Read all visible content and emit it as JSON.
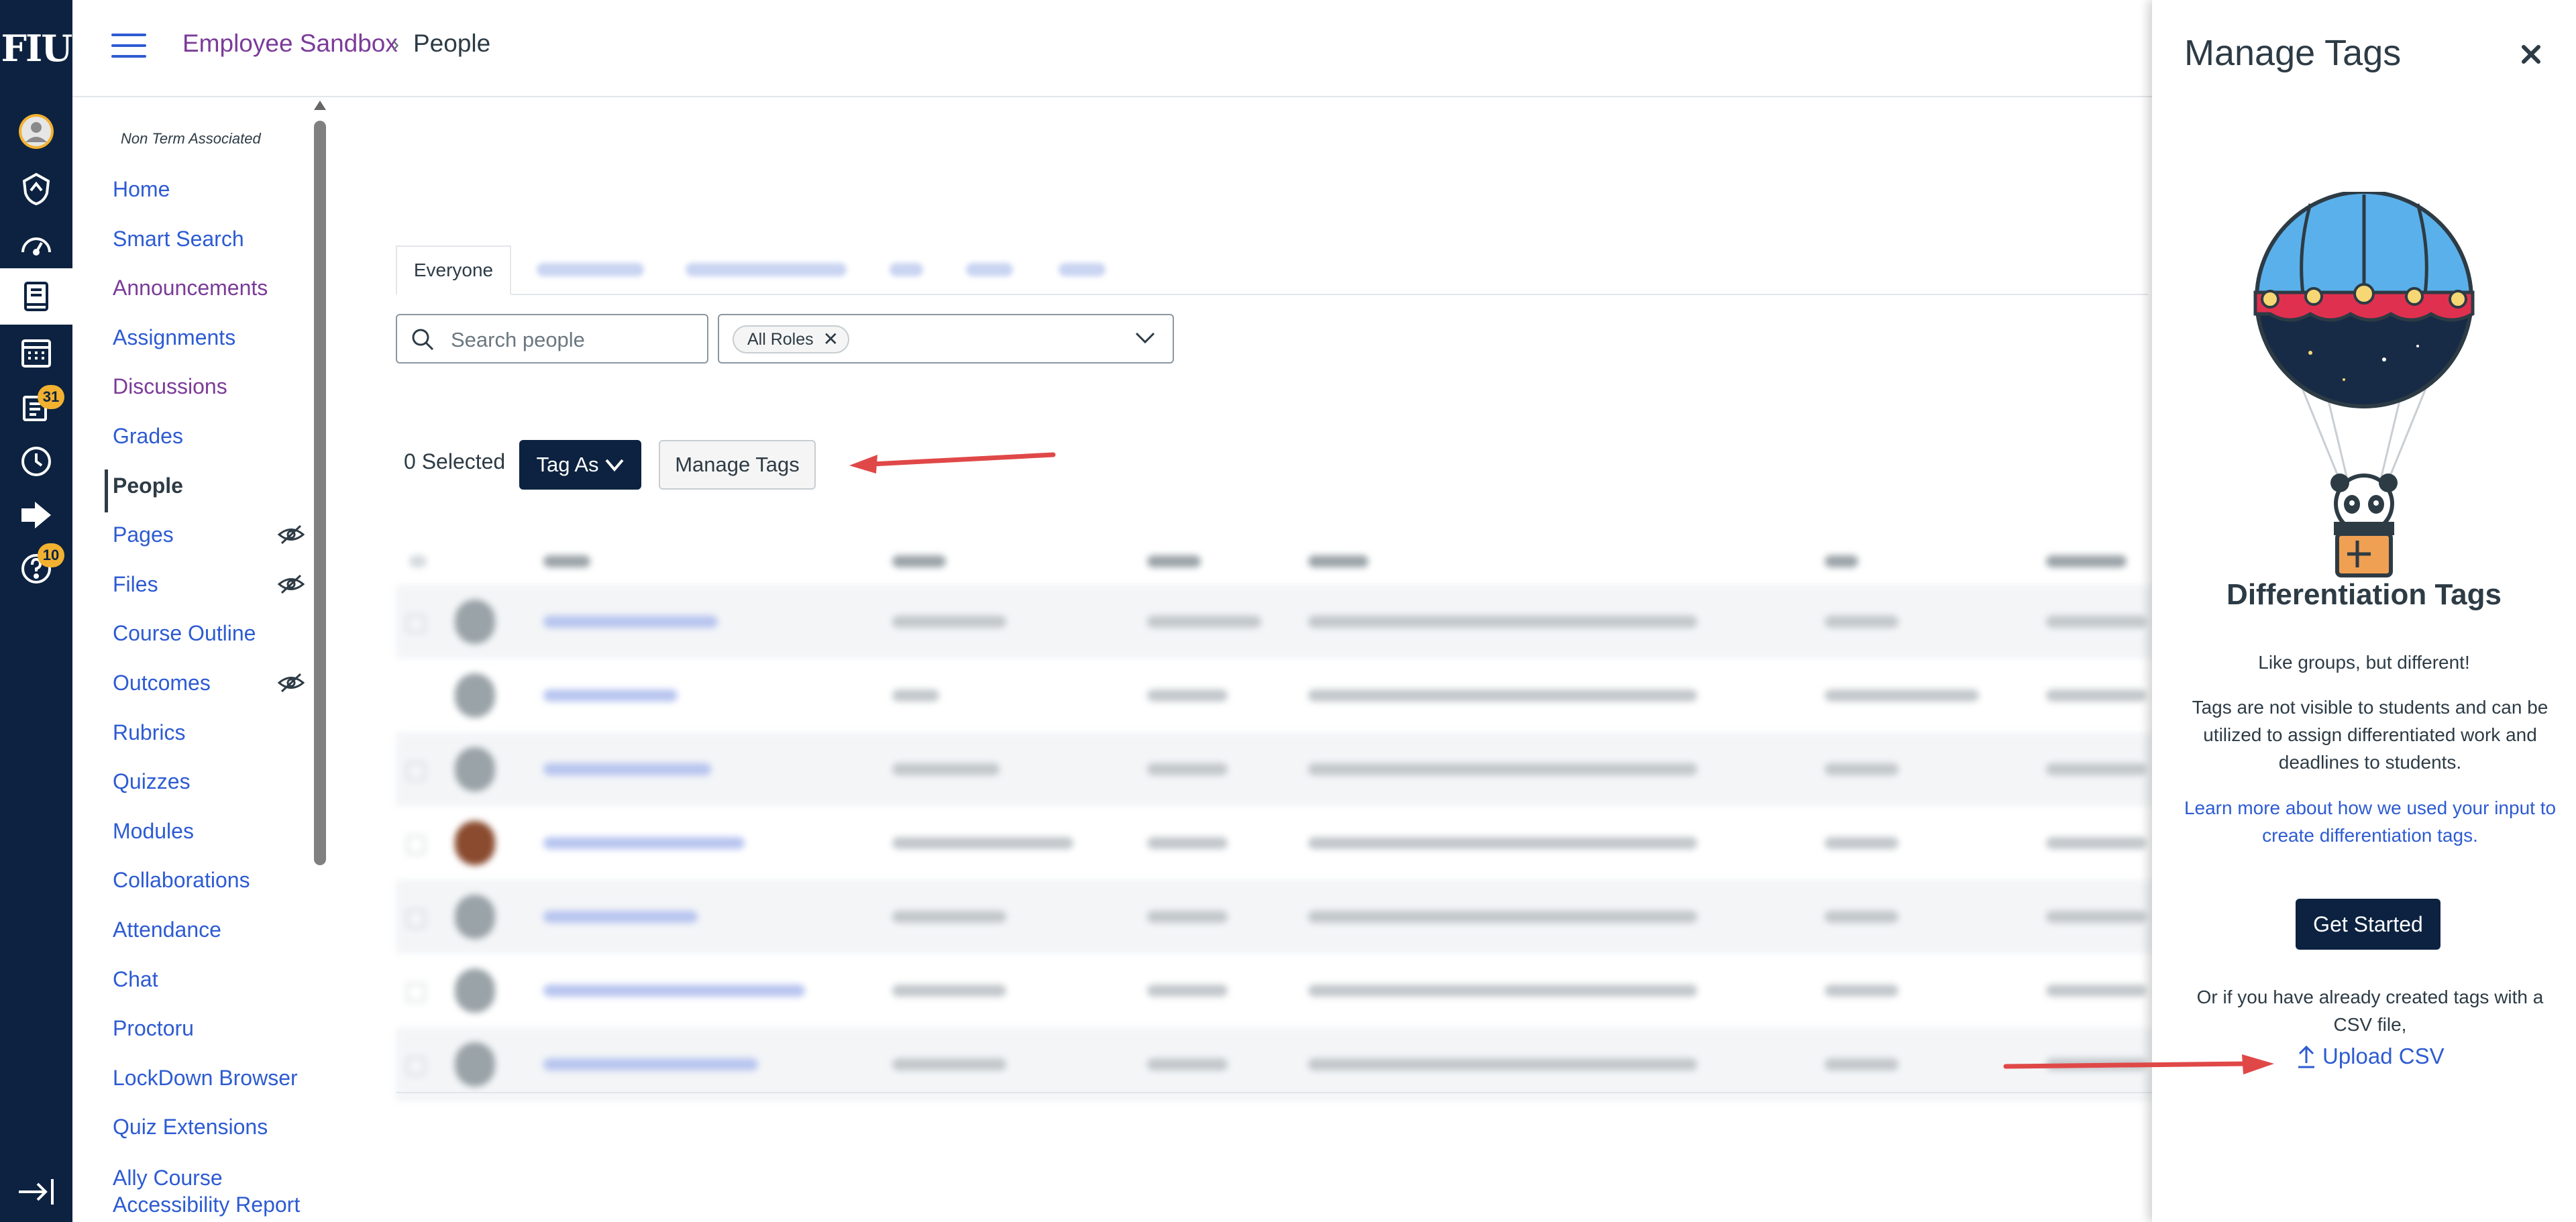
{
  "global_nav": {
    "logo": "FIU",
    "badges": {
      "inbox": "31",
      "help": "10"
    }
  },
  "header": {
    "course_name": "Employee Sandbox",
    "separator": "›",
    "page": "People"
  },
  "course_nav": {
    "term": "Non Term Associated",
    "items": [
      {
        "label": "Home"
      },
      {
        "label": "Smart Search"
      },
      {
        "label": "Announcements"
      },
      {
        "label": "Assignments"
      },
      {
        "label": "Discussions"
      },
      {
        "label": "Grades"
      },
      {
        "label": "People"
      },
      {
        "label": "Pages"
      },
      {
        "label": "Files"
      },
      {
        "label": "Course Outline"
      },
      {
        "label": "Outcomes"
      },
      {
        "label": "Rubrics"
      },
      {
        "label": "Quizzes"
      },
      {
        "label": "Modules"
      },
      {
        "label": "Collaborations"
      },
      {
        "label": "Attendance"
      },
      {
        "label": "Chat"
      },
      {
        "label": "Proctoru"
      },
      {
        "label": "LockDown Browser"
      },
      {
        "label": "Quiz Extensions"
      },
      {
        "label": "Ally Course Accessibility Report"
      }
    ]
  },
  "people": {
    "tab_active": "Everyone",
    "search_placeholder": "Search people",
    "role_filter": "All Roles",
    "selected_count": "0 Selected",
    "tag_as": "Tag As",
    "manage_tags": "Manage Tags"
  },
  "tray": {
    "title": "Manage Tags",
    "heading": "Differentiation Tags",
    "tagline": "Like groups, but different!",
    "description": "Tags are not visible to students and can be utilized to assign differentiated work and deadlines to students.",
    "learn_more": "Learn more about how we used your input to create differentiation tags.",
    "get_started": "Get Started",
    "csv_note": "Or if you have already created tags with a CSV file,",
    "upload_csv": "Upload CSV"
  },
  "colors": {
    "nav_bg": "#0c2240",
    "link": "#2d5bd2",
    "visited": "#7b3b99",
    "badge": "#f2b130",
    "annotation_arrow": "#e04848"
  }
}
